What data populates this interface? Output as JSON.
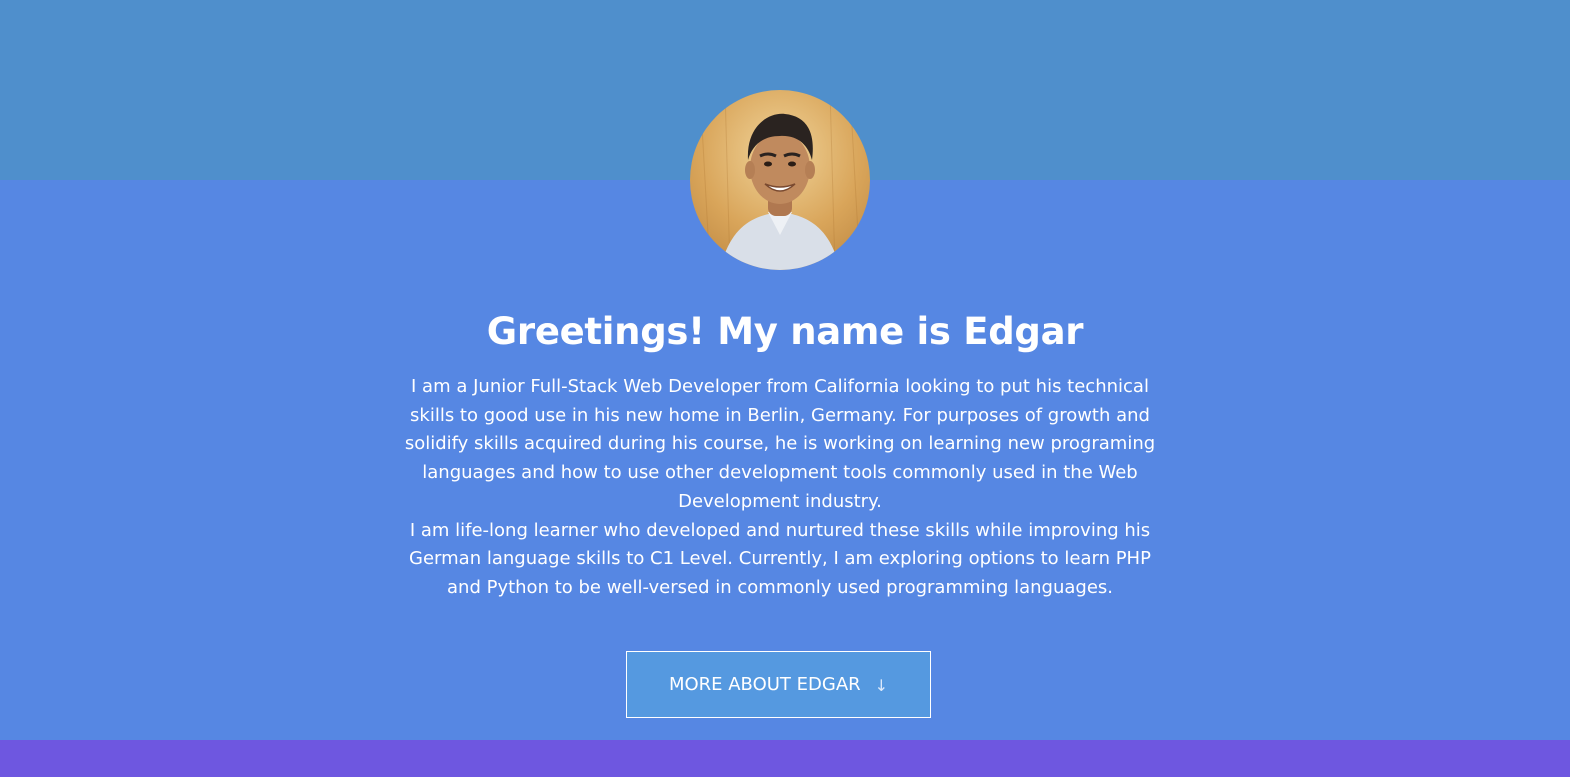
{
  "hero": {
    "heading": "Greetings! My name is Edgar",
    "bio_paragraph_1": "I am a Junior Full-Stack Web Developer from California looking to put his technical skills to good use in his new home in Berlin, Germany. For purposes of growth and solidify skills acquired during his course, he is working on learning new programing languages and how to use other development tools commonly used in the Web Development industry.",
    "bio_paragraph_2": "I am life-long learner who developed and nurtured these skills while improving his German language skills to C1 Level. Currently, I am exploring options to learn PHP and Python to be well-versed in commonly used programming languages.",
    "cta_label": "MORE ABOUT EDGAR",
    "cta_icon": "arrow-down-icon",
    "avatar_alt": "profile-photo"
  },
  "colors": {
    "top_band": "#4f8fcc",
    "hero_background": "#5687e3",
    "bottom_band": "#6e57e0",
    "button_background": "#5599e0",
    "text": "#ffffff"
  }
}
